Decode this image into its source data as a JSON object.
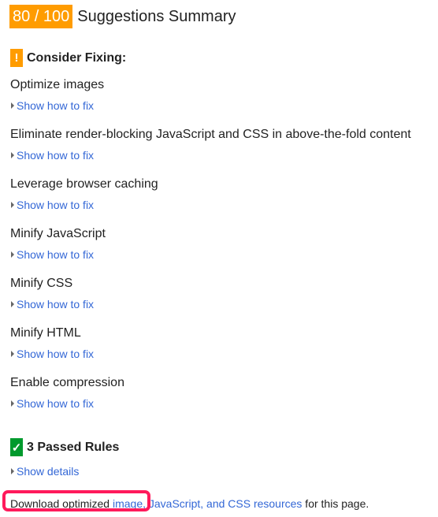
{
  "header": {
    "score": "80 / 100",
    "title": "Suggestions Summary",
    "score_color": "#ff9c00"
  },
  "consider": {
    "icon": "exclamation-icon",
    "badge": "!",
    "label": "Consider Fixing:"
  },
  "rules": [
    {
      "name": "Optimize images",
      "link": "Show how to fix"
    },
    {
      "name": "Eliminate render-blocking JavaScript and CSS in above-the-fold content",
      "link": "Show how to fix"
    },
    {
      "name": "Leverage browser caching",
      "link": "Show how to fix"
    },
    {
      "name": "Minify JavaScript",
      "link": "Show how to fix"
    },
    {
      "name": "Minify CSS",
      "link": "Show how to fix"
    },
    {
      "name": "Minify HTML",
      "link": "Show how to fix"
    },
    {
      "name": "Enable compression",
      "link": "Show how to fix"
    }
  ],
  "passed": {
    "icon": "checkmark-icon",
    "badge": "✓",
    "label": "3 Passed Rules",
    "link": "Show details"
  },
  "download": {
    "prefix": "Download optimized ",
    "link1": "image,",
    "link2": "JavaScript, and CSS resources",
    "suffix": " for this page."
  }
}
